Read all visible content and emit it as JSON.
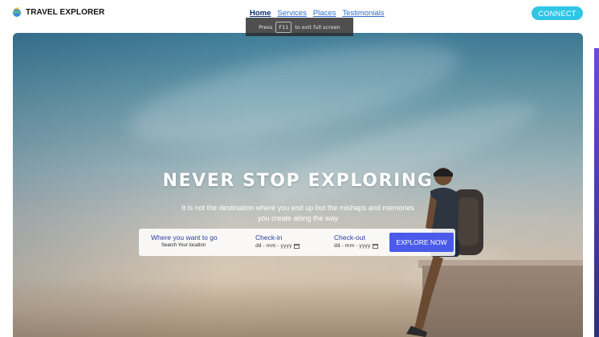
{
  "brand": {
    "name": "TRAVEL EXPLORER"
  },
  "nav": {
    "items": [
      "Home",
      "Services",
      "Places",
      "Testimonials"
    ],
    "active_index": 0
  },
  "header": {
    "connect_label": "CONNECT"
  },
  "fullscreen_hint": {
    "prefix": "Press",
    "key": "F11",
    "suffix": "to exit full screen"
  },
  "hero": {
    "title": "NEVER STOP EXPLORING",
    "subtitle": "It is not the destination where you end up but the mishaps and memories you create along the way"
  },
  "search": {
    "destination_label": "Where you want to go",
    "destination_placeholder": "Search Your location",
    "checkin_label": "Check-in",
    "checkin_value": "dd - mm - yyyy",
    "checkout_label": "Check-out",
    "checkout_value": "dd - mm - yyyy",
    "button_label": "EXPLORE NOW"
  },
  "colors": {
    "accent": "#2fc6e6",
    "button": "#4a5bea",
    "nav_link": "#2f6dd0"
  }
}
